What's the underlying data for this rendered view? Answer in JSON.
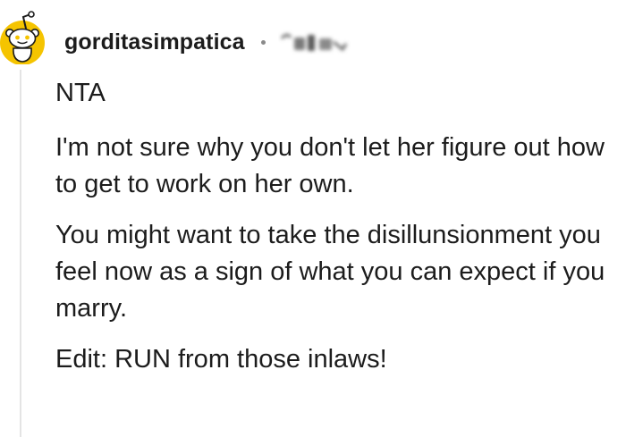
{
  "comment": {
    "username": "gorditasimpatica",
    "paragraphs": {
      "verdict": "NTA",
      "p1": "I'm not sure why you don't let her figure out how to get to work on her own.",
      "p2": "You might want to take the disillunsionment you feel now as a sign of what you can expect if you marry.",
      "p3": "Edit: RUN from those inlaws!"
    }
  },
  "icons": {
    "avatar": "reddit-snoo-avatar-icon",
    "separator": "dot-separator",
    "redacted": "redacted-meta-badge"
  },
  "colors": {
    "avatar_bg": "#f5c400",
    "text": "#1c1c1c",
    "thread_line": "#e4e4e4",
    "separator": "#8a8a8a"
  }
}
